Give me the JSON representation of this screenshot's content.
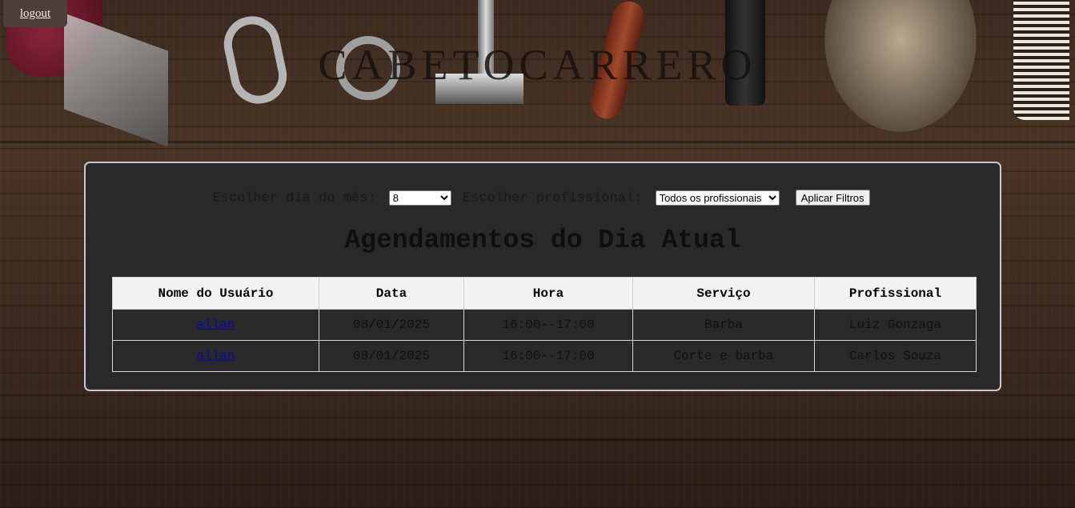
{
  "header": {
    "logout_label": "logout",
    "brand": "CABETOCARRERO"
  },
  "filters": {
    "day_label": "Escolher dia do mês:",
    "day_selected": "8",
    "professional_label": "Escolher profissional:",
    "professional_selected": "Todos os profissionais",
    "apply_label": "Aplicar Filtros"
  },
  "main": {
    "title": "Agendamentos do Dia Atual"
  },
  "table": {
    "columns": [
      "Nome do Usuário",
      "Data",
      "Hora",
      "Serviço",
      "Profissional"
    ],
    "rows": [
      [
        "allan",
        "08/01/2025",
        "16:00--17:00",
        "Barba",
        "Luiz Gonzaga"
      ],
      [
        "allan",
        "08/01/2025",
        "16:00--17:00",
        "Corte e barba",
        "Carlos Souza"
      ]
    ]
  },
  "icons": [
    "clipper-icon",
    "scissors-icon",
    "razor-icon",
    "straight-razor-icon",
    "shaving-brush-icon",
    "comb-icon"
  ],
  "colors": {
    "panel_bg": "#292929",
    "link": "#0a0aa8",
    "header_bg": "#f2f2f2"
  }
}
